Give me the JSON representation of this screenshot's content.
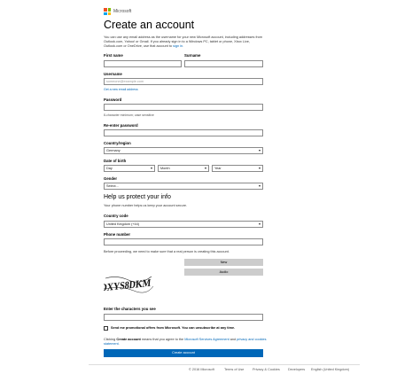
{
  "header": {
    "brand": "Microsoft",
    "logo_colors": [
      "#f25022",
      "#7fba00",
      "#00a4ef",
      "#ffb900"
    ]
  },
  "page_title": "Create an account",
  "intro": {
    "text": "You can use any email address as the username for your new Microsoft account, including addresses from Outlook.com, Yahoo! or Gmail. If you already sign in to a Windows PC, tablet or phone, Xbox Live, Outlook.com or OneDrive, use that account to",
    "link": "sign in."
  },
  "form": {
    "first_name_label": "First name",
    "surname_label": "Surname",
    "username_label": "Username",
    "username_placeholder": "someone@example.com",
    "get_new_email_link": "Get a new email address",
    "password_label": "Password",
    "password_hint": "8-character minimum; case sensitive",
    "reenter_password_label": "Re-enter password",
    "country_label": "Country/region",
    "country_value": "Germany",
    "dob_label": "Date of birth",
    "dob_day": "Day",
    "dob_month": "Month",
    "dob_year": "Year",
    "gender_label": "Gender",
    "gender_value": "Select...",
    "protect_heading": "Help us protect your info",
    "protect_text": "Your phone number helps us keep your account secure.",
    "country_code_label": "Country code",
    "country_code_value": "United Kingdom (+44)",
    "phone_label": "Phone number",
    "captcha_intro": "Before proceeding, we need to make sure that a real person is creating this account.",
    "captcha_new_button": "New",
    "captcha_audio_button": "Audio",
    "captcha_text": "DXYS8DKM",
    "captcha_input_label": "Enter the characters you see",
    "promo_checkbox_label": "Send me promotional offers from Microsoft. You can unsubscribe at any time.",
    "terms_prefix": "Clicking",
    "terms_bold": "Create account",
    "terms_middle": "means that you agree to the",
    "terms_link1": "Microsoft Services Agreement",
    "terms_and": "and",
    "terms_link2": "privacy and cookies statement.",
    "create_button": "Create account"
  },
  "footer": {
    "copyright": "© 2016 Microsoft",
    "links": [
      "Terms of Use",
      "Privacy & Cookies",
      "Developers",
      "English (United Kingdom)"
    ]
  }
}
